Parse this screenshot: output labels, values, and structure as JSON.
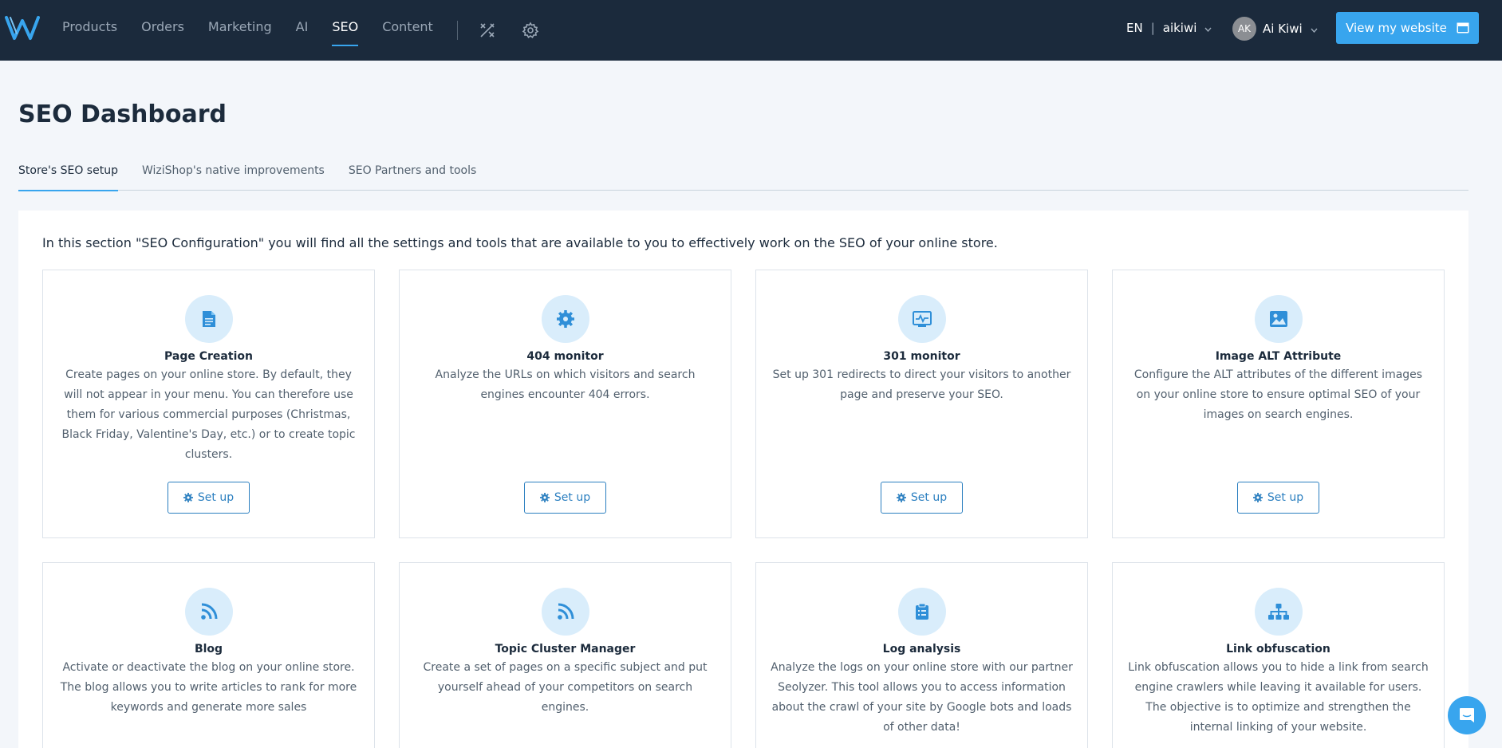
{
  "nav": {
    "items": [
      {
        "label": "Products",
        "active": false
      },
      {
        "label": "Orders",
        "active": false
      },
      {
        "label": "Marketing",
        "active": false
      },
      {
        "label": "AI",
        "active": false
      },
      {
        "label": "SEO",
        "active": true
      },
      {
        "label": "Content",
        "active": false
      }
    ],
    "lang": "EN",
    "store": "aikiwi",
    "user_initials": "AK",
    "user_name": "Ai Kiwi",
    "view_website": "View my website"
  },
  "page": {
    "title": "SEO Dashboard",
    "tabs": [
      {
        "label": "Store's SEO setup",
        "active": true
      },
      {
        "label": "WiziShop's native improvements",
        "active": false
      },
      {
        "label": "SEO Partners and tools",
        "active": false
      }
    ],
    "intro": "In this section \"SEO Configuration\" you will find all the settings and tools that are available to you to effectively work on the SEO of your online store."
  },
  "cards": [
    {
      "icon": "document-icon",
      "title": "Page Creation",
      "desc": "Create pages on your online store. By default, they will not appear in your menu. You can therefore use them for various commercial purposes (Christmas, Black Friday, Valentine's Day, etc.) or to create topic clusters.",
      "button": "Set up"
    },
    {
      "icon": "gear-icon",
      "title": "404 monitor",
      "desc": "Analyze the URLs on which visitors and search engines encounter 404 errors.",
      "button": "Set up"
    },
    {
      "icon": "monitor-icon",
      "title": "301 monitor",
      "desc": "Set up 301 redirects to direct your visitors to another page and preserve your SEO.",
      "button": "Set up"
    },
    {
      "icon": "image-icon",
      "title": "Image ALT Attribute",
      "desc": "Configure the ALT attributes of the different images on your online store to ensure optimal SEO of your images on search engines.",
      "button": "Set up"
    },
    {
      "icon": "rss-icon",
      "title": "Blog",
      "desc": "Activate or deactivate the blog on your online store. The blog allows you to write articles to rank for more keywords and generate more sales",
      "button": ""
    },
    {
      "icon": "rss-icon",
      "title": "Topic Cluster Manager",
      "desc": "Create a set of pages on a specific subject and put yourself ahead of your competitors on search engines.",
      "button": ""
    },
    {
      "icon": "clipboard-icon",
      "title": "Log analysis",
      "desc": "Analyze the logs on your online store with our partner Seolyzer. This tool allows you to access information about the crawl of your site by Google bots and loads of other data!",
      "button": ""
    },
    {
      "icon": "sitemap-icon",
      "title": "Link obfuscation",
      "desc": "Link obfuscation allows you to hide a link from search engine crawlers while leaving it available for users. The objective is to optimize and strengthen the internal linking of your website.",
      "button": ""
    }
  ],
  "colors": {
    "navbar": "#1b2a3c",
    "accent": "#38a5ee",
    "button_outline": "#2b7fc0",
    "icon_circle": "#d9edfb"
  }
}
